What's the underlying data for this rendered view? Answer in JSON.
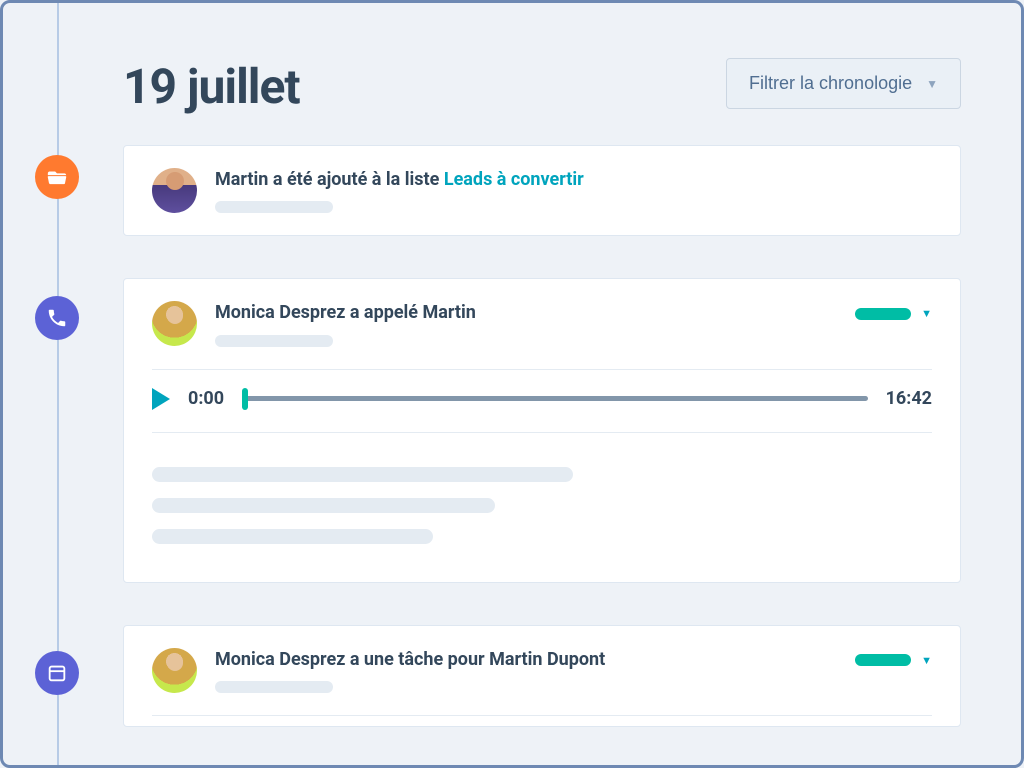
{
  "colors": {
    "accent_teal": "#00bda5",
    "link_teal": "#00a4bd",
    "icon_orange": "#ff7a2f",
    "icon_purple": "#5c62d6"
  },
  "header": {
    "date_label": "19 juillet",
    "filter_label": "Filtrer la chronologie"
  },
  "timeline": [
    {
      "icon": "folder",
      "avatar": "martin",
      "title_prefix": "Martin a été ajouté à la liste ",
      "title_link": "Leads à convertir"
    },
    {
      "icon": "phone",
      "avatar": "monica",
      "title": "Monica Desprez a appelé Martin",
      "call": {
        "current_time": "0:00",
        "duration": "16:42"
      }
    },
    {
      "icon": "calendar",
      "avatar": "monica",
      "title": "Monica Desprez a une tâche pour Martin Dupont"
    }
  ]
}
